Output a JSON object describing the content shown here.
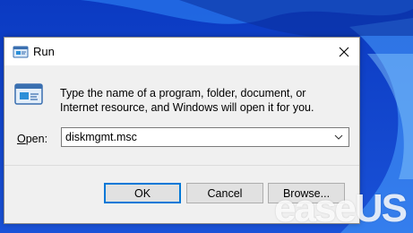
{
  "window": {
    "title": "Run",
    "description": "Type the name of a program, folder, document, or Internet resource, and Windows will open it for you.",
    "open_label_prefix": "",
    "open_label_underlined": "O",
    "open_label_suffix": "pen:",
    "command_value": "diskmgmt.msc"
  },
  "buttons": {
    "ok": "OK",
    "cancel": "Cancel",
    "browse": "Browse..."
  },
  "watermark": {
    "text": "easeUS"
  },
  "icons": {
    "title": "run-app-icon",
    "big": "run-app-icon",
    "close": "close-icon",
    "dropdown": "chevron-down-icon"
  },
  "colors": {
    "desktop_blue": "#1e5fd6",
    "default_button_border": "#0078d7",
    "dialog_bg": "#f0f0f0"
  }
}
